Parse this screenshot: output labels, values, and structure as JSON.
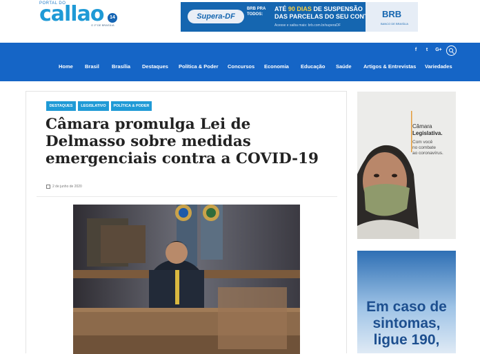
{
  "site": {
    "logo_small": "PORTAL DO",
    "logo_main": "callao",
    "logo_badge": "14",
    "logo_sub": "O 1º DE BRASÍLIA"
  },
  "banner": {
    "pill": "Supera-DF",
    "brb_pra": "BRB PRA TODOS:",
    "line1_a": "ATÉ",
    "line1_b": "90 DIAS",
    "line1_c": "DE SUSPENSÃO",
    "line2": "DAS PARCELAS DO SEU CONTRATO.",
    "fine": "Acesse e saiba mais: brb.com.br/superaDF",
    "brand": "BRB",
    "brand_sub": "BANCO DE BRASÍLIA"
  },
  "social": {
    "facebook": "f",
    "twitter": "t",
    "google": "G+"
  },
  "nav": {
    "items": [
      "Home",
      "Brasil",
      "Brasília",
      "Destaques",
      "Política & Poder",
      "Concursos",
      "Economia",
      "Educação",
      "Saúde",
      "Artigos & Entrevistas",
      "Variedades"
    ]
  },
  "article": {
    "tags": [
      "DESTAQUES",
      "LEGISLATIVO",
      "POLÍTICA & PODER"
    ],
    "title": "Câmara promulga Lei de Delmasso sobre medidas emergenciais contra a COVID-19",
    "date": "2 de junho de 2020"
  },
  "ad1": {
    "brand_line1": "Câmara",
    "brand_line2": "Legislativa.",
    "tagline1": "Com você",
    "tagline2": "no combate",
    "tagline3": "ao coronavírus."
  },
  "ad2": {
    "line1": "Em caso de",
    "line2": "sintomas,",
    "line3": "ligue 190,"
  },
  "colors": {
    "nav_blue": "#1565c6",
    "tag_blue": "#1f9ad6",
    "banner_blue": "#1566b0"
  }
}
